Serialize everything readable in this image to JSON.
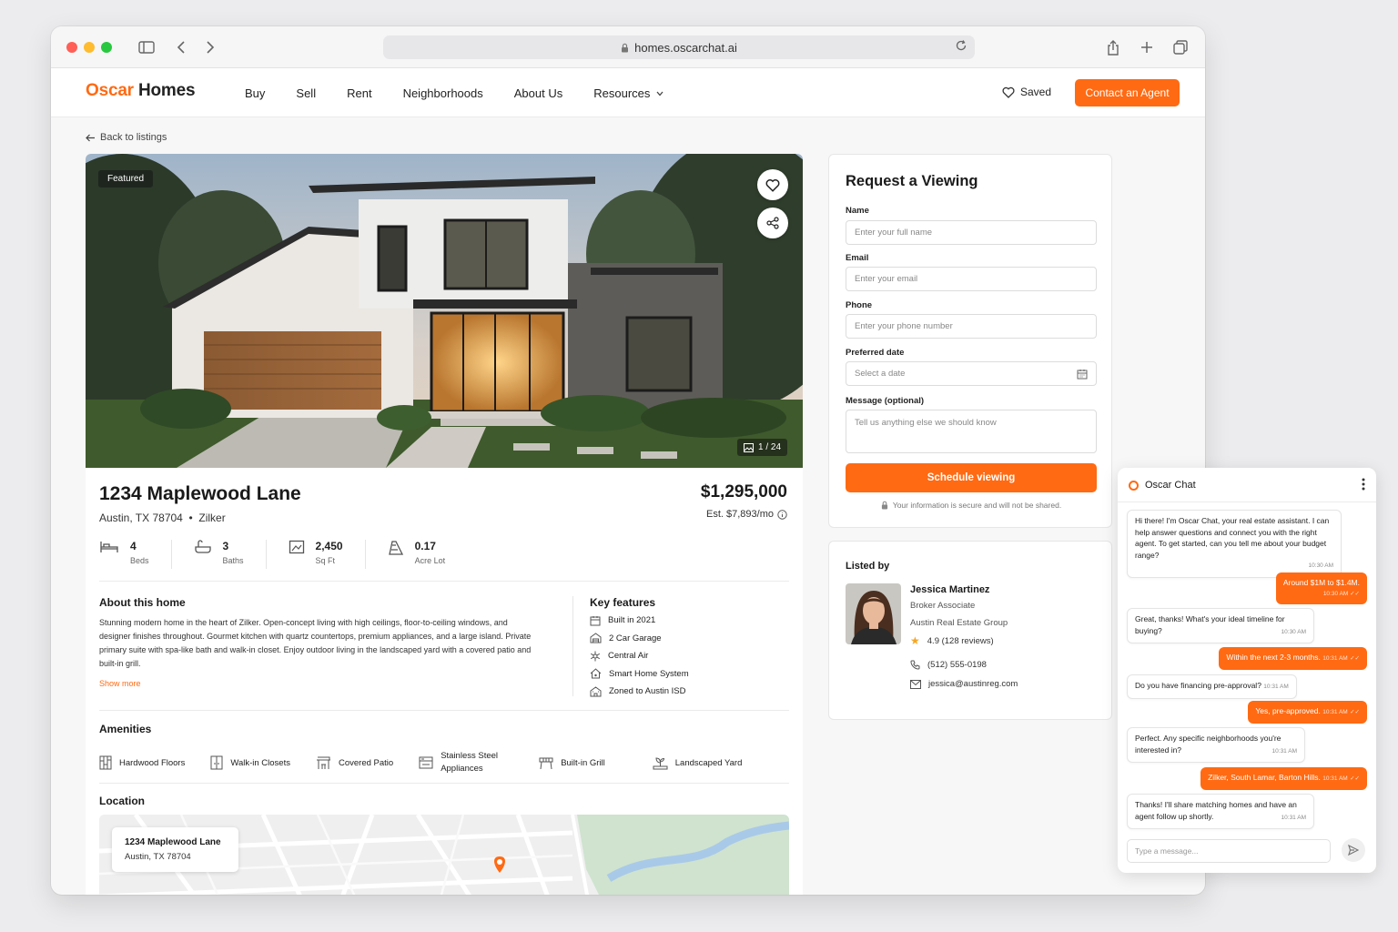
{
  "browser": {
    "url": "homes.oscarchat.ai"
  },
  "nav": {
    "logo_brand": "Oscar",
    "logo_rest": " Homes",
    "items": [
      "Buy",
      "Sell",
      "Rent",
      "Neighborhoods",
      "About Us",
      "Resources"
    ],
    "saved": "Saved",
    "cta": "Contact an Agent"
  },
  "back": "Back to listings",
  "listing": {
    "badge": "Featured",
    "photo_counter": "1 / 24",
    "address": "1234 Maplewood Lane",
    "city": "Austin, TX 78704",
    "neighborhood": "Zilker",
    "price": "$1,295,000",
    "estimate": "Est. $7,893/mo",
    "stats": [
      {
        "value": "4",
        "label": "Beds",
        "icon": "bed-icon"
      },
      {
        "value": "3",
        "label": "Baths",
        "icon": "bath-icon"
      },
      {
        "value": "2,450",
        "label": "Sq Ft",
        "icon": "area-icon"
      },
      {
        "value": "0.17",
        "label": "Acre Lot",
        "icon": "lot-icon"
      }
    ],
    "about_title": "About this home",
    "about_text": "Stunning modern home in the heart of Zilker. Open-concept living with high ceilings, floor-to-ceiling windows, and designer finishes throughout. Gourmet kitchen with quartz countertops, premium appliances, and a large island. Private primary suite with spa-like bath and walk-in closet. Enjoy outdoor living in the landscaped yard with a covered patio and built-in grill.",
    "show_more": "Show more",
    "features_title": "Key features",
    "features": [
      "Built in 2021",
      "2 Car Garage",
      "Central Air",
      "Smart Home System",
      "Zoned to Austin ISD"
    ],
    "amenities_title": "Amenities",
    "amenities": [
      "Hardwood Floors",
      "Walk-in Closets",
      "Covered Patio",
      "Stainless Steel Appliances",
      "Built-in Grill",
      "Landscaped Yard"
    ],
    "location_title": "Location",
    "map_card_line1": "1234 Maplewood Lane",
    "map_card_line2": "Austin, TX 78704"
  },
  "form": {
    "title": "Request a Viewing",
    "name_label": "Name",
    "name_ph": "Enter your full name",
    "email_label": "Email",
    "email_ph": "Enter your email",
    "phone_label": "Phone",
    "phone_ph": "Enter your phone number",
    "date_label": "Preferred date",
    "date_ph": "Select a date",
    "message_label": "Message (optional)",
    "message_ph": "Tell us anything else we should know",
    "submit": "Schedule viewing",
    "secure": "Your information is secure and will not be shared."
  },
  "agent": {
    "listed_by": "Listed by",
    "name": "Jessica Martinez",
    "title": "Broker Associate",
    "company": "Austin Real Estate Group",
    "rating": "4.9 (128 reviews)",
    "phone": "(512) 555-0198",
    "email": "jessica@austinreg.com"
  },
  "chat": {
    "title": "Oscar Chat",
    "input_ph": "Type a message...",
    "messages": [
      {
        "from": "bot",
        "text": "Hi there! I'm Oscar Chat, your real estate assistant. I can help answer questions and connect you with the right agent. To get started, can you tell me about your budget range?",
        "time": "10:30 AM"
      },
      {
        "from": "user",
        "text": "Around $1M to $1.4M.",
        "time": "10:30 AM"
      },
      {
        "from": "bot",
        "text": "Great, thanks! What's your ideal timeline for buying?",
        "time": "10:30 AM"
      },
      {
        "from": "user",
        "text": "Within the next 2-3 months.",
        "time": "10:31 AM"
      },
      {
        "from": "bot",
        "text": "Do you have financing pre-approval?",
        "time": "10:31 AM"
      },
      {
        "from": "user",
        "text": "Yes, pre-approved.",
        "time": "10:31 AM"
      },
      {
        "from": "bot",
        "text": "Perfect. Any specific neighborhoods you're interested in?",
        "time": "10:31 AM"
      },
      {
        "from": "user",
        "text": "Zilker, South Lamar, Barton Hills.",
        "time": "10:31 AM"
      },
      {
        "from": "bot",
        "text": "Thanks! I'll share matching homes and have an agent follow up shortly.",
        "time": "10:31 AM"
      }
    ]
  },
  "colors": {
    "accent": "#ff6a13"
  }
}
